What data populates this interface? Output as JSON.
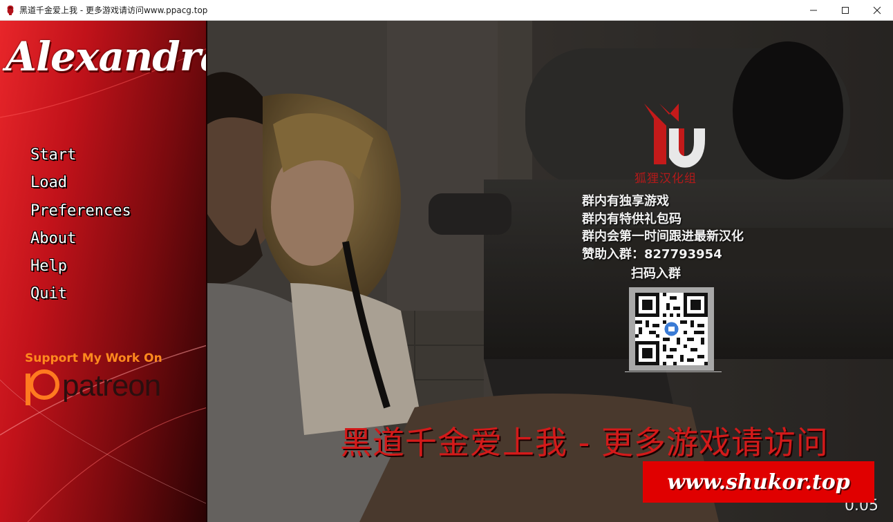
{
  "window": {
    "title": "黑道千金爱上我 - 更多游戏请访问www.ppacg.top",
    "icon": "app-icon",
    "controls": [
      "minimize-icon",
      "maximize-icon",
      "close-icon"
    ]
  },
  "game": {
    "logo_text": "Alexandra",
    "menu": {
      "items": [
        {
          "label": "Start"
        },
        {
          "label": "Load"
        },
        {
          "label": "Preferences"
        },
        {
          "label": "About"
        },
        {
          "label": "Help"
        },
        {
          "label": "Quit"
        }
      ]
    },
    "support": {
      "text": "Support My Work On",
      "brand": "patreon",
      "icon": "patreon-icon"
    },
    "version_fragment": "0.05"
  },
  "watermark": {
    "group_name": "狐狸汉化组",
    "promo_lines": [
      "群内有独享游戏",
      "群内有特供礼包码",
      "群内会第一时间跟进最新汉化",
      "赞助入群：827793954"
    ],
    "scan_label": "扫码入群",
    "banner": "黑道千金爱上我 - 更多游戏请访问",
    "url": "www.shukor.top"
  },
  "colors": {
    "panel_red": "#c1121a",
    "banner_red": "#d31a1a",
    "url_box_red": "#e00000",
    "support_orange": "#ff8a1e"
  }
}
